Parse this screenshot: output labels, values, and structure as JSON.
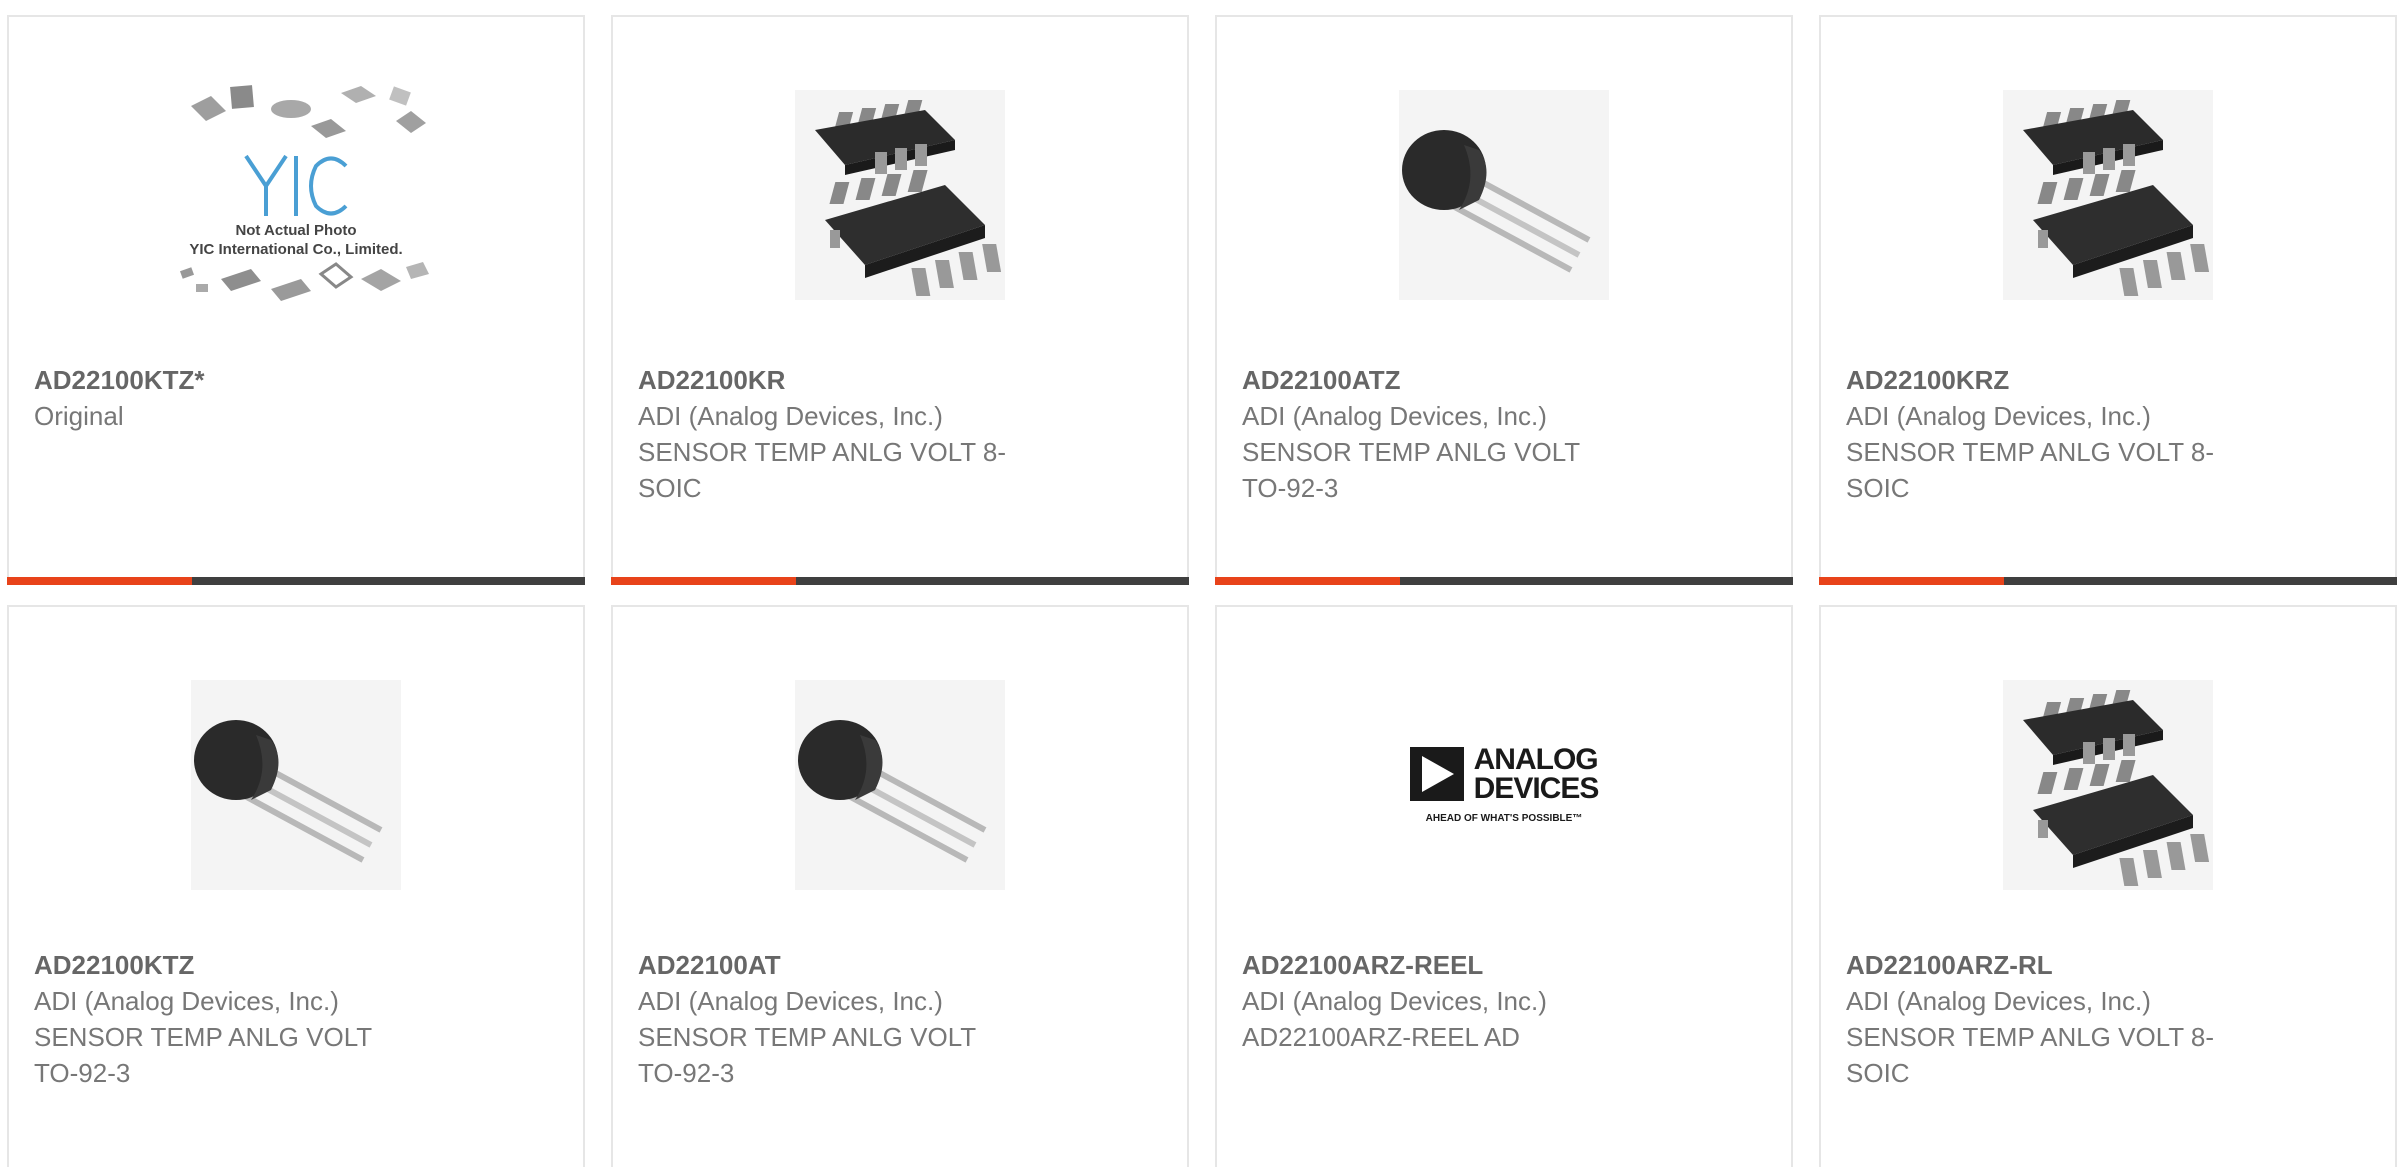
{
  "products": [
    {
      "part_number": "AD22100KTZ*",
      "manufacturer": "Original",
      "description": "",
      "image": "not-actual-photo-placeholder",
      "placeholder_text_1": "Not Actual Photo",
      "placeholder_text_2": "YIC International Co., Limited.",
      "progress": 0.32
    },
    {
      "part_number": "AD22100KR",
      "manufacturer": "ADI (Analog Devices, Inc.)",
      "description": "SENSOR TEMP ANLG VOLT 8-SOIC",
      "image": "soic-8-package",
      "progress": 0.32
    },
    {
      "part_number": "AD22100ATZ",
      "manufacturer": "ADI (Analog Devices, Inc.)",
      "description": "SENSOR TEMP ANLG VOLT TO-92-3",
      "image": "to-92-package",
      "progress": 0.32
    },
    {
      "part_number": "AD22100KRZ",
      "manufacturer": "ADI (Analog Devices, Inc.)",
      "description": "SENSOR TEMP ANLG VOLT 8-SOIC",
      "image": "soic-8-package",
      "progress": 0.32
    },
    {
      "part_number": "AD22100KTZ",
      "manufacturer": "ADI (Analog Devices, Inc.)",
      "description": "SENSOR TEMP ANLG VOLT TO-92-3",
      "image": "to-92-package"
    },
    {
      "part_number": "AD22100AT",
      "manufacturer": "ADI (Analog Devices, Inc.)",
      "description": "SENSOR TEMP ANLG VOLT TO-92-3",
      "image": "to-92-package"
    },
    {
      "part_number": "AD22100ARZ-REEL",
      "manufacturer": "ADI (Analog Devices, Inc.)",
      "description": "AD22100ARZ-REEL AD",
      "image": "analog-devices-logo",
      "logo_line_1": "ANALOG",
      "logo_line_2": "DEVICES",
      "logo_tagline": "AHEAD OF WHAT'S POSSIBLE™"
    },
    {
      "part_number": "AD22100ARZ-RL",
      "manufacturer": "ADI (Analog Devices, Inc.)",
      "description": "SENSOR TEMP ANLG VOLT 8-SOIC",
      "image": "soic-8-package"
    }
  ],
  "colors": {
    "accent": "#e8431a",
    "track": "#3f3f3f",
    "border": "#e6e6e6",
    "part_text": "#666666",
    "body_text": "#777777"
  }
}
